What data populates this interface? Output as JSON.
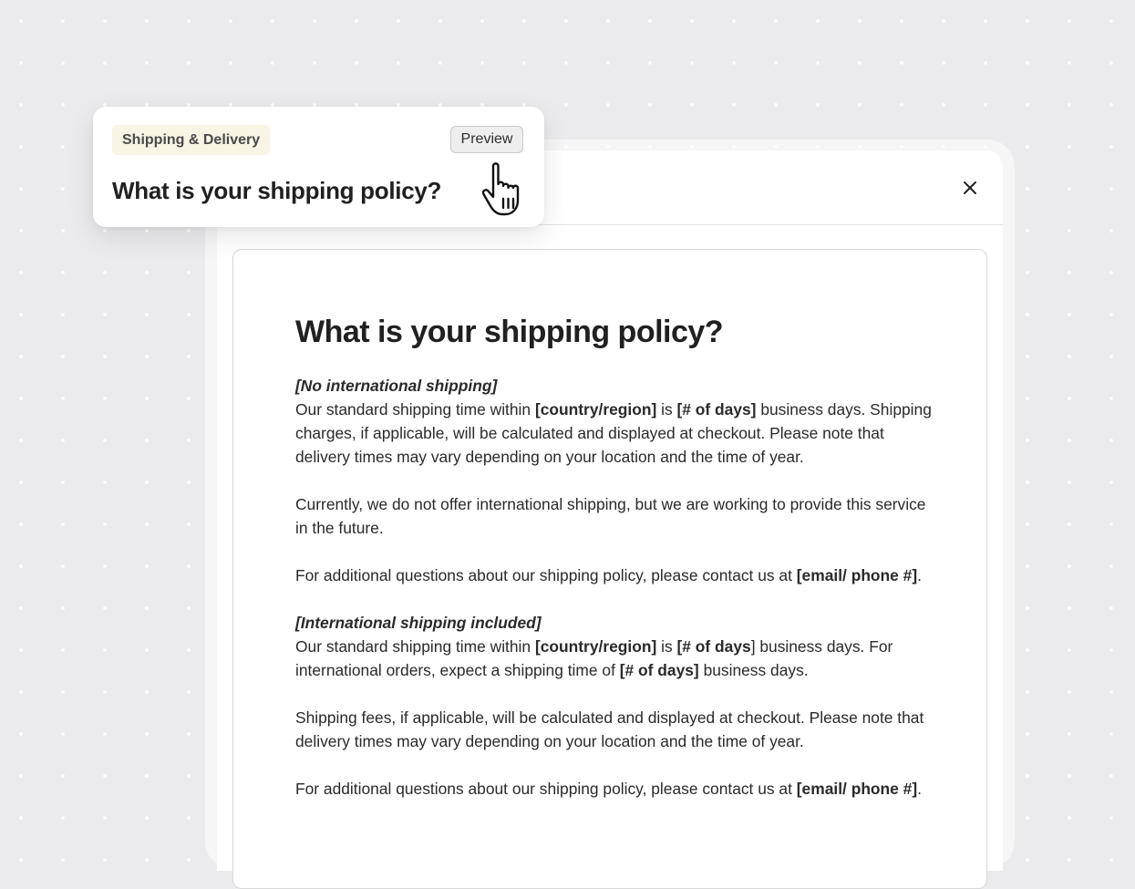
{
  "float_card": {
    "category": "Shipping & Delivery",
    "preview_label": "Preview",
    "title": "What is your shipping policy?"
  },
  "modal": {
    "close_icon": "close-icon",
    "document": {
      "title": "What is your shipping policy?",
      "section1": {
        "label": "[No international shipping]",
        "p1_a": "Our standard shipping time within ",
        "p1_b": "[country/region]",
        "p1_c": " is ",
        "p1_d": "[# of days]",
        "p1_e": " business days. Shipping charges, if applicable, will be calculated and displayed at checkout. Please note that delivery times may vary depending on your location and the time of year.",
        "p2": "Currently, we do not offer international shipping, but we are working to provide this service in the future.",
        "p3_a": "For additional questions about our shipping policy, please contact us at ",
        "p3_b": "[email/ phone #]",
        "p3_c": "."
      },
      "section2": {
        "label": "[International shipping included]",
        "p1_a": "Our standard shipping time within ",
        "p1_b": "[country/region]",
        "p1_c": " is ",
        "p1_d": "[# of days",
        "p1_e": "] business days. For international orders, expect a shipping time of ",
        "p1_f": "[# of days]",
        "p1_g": " business days.",
        "p2": "Shipping fees, if applicable, will be calculated and displayed at checkout. Please note that delivery times may vary depending on your location and the time of year.",
        "p3_a": "For additional questions about our shipping policy, please contact us at ",
        "p3_b": "[email/ phone #]",
        "p3_c": "."
      }
    }
  },
  "cursor": "hand-pointer-icon"
}
